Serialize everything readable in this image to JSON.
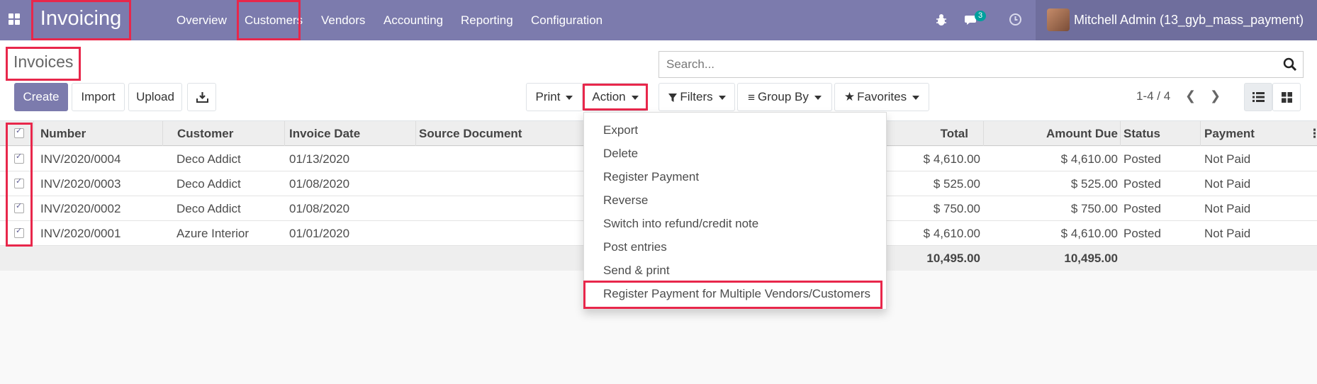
{
  "navbar": {
    "brand": "Invoicing",
    "menu": [
      "Overview",
      "Customers",
      "Vendors",
      "Accounting",
      "Reporting",
      "Configuration"
    ],
    "message_count": "3",
    "user_name": "Mitchell Admin (13_gyb_mass_payment)"
  },
  "page": {
    "title": "Invoices"
  },
  "search": {
    "placeholder": "Search..."
  },
  "buttons": {
    "create": "Create",
    "import": "Import",
    "upload": "Upload",
    "print": "Print",
    "action": "Action",
    "filters": "Filters",
    "group_by": "Group By",
    "favorites": "Favorites"
  },
  "pager": {
    "value": "1-4 / 4"
  },
  "table": {
    "headers": [
      "Number",
      "Customer",
      "Invoice Date",
      "Source Document",
      "Total",
      "Amount Due",
      "Status",
      "Payment"
    ],
    "rows": [
      {
        "number": "INV/2020/0004",
        "customer": "Deco Addict",
        "date": "01/13/2020",
        "total": "$ 4,610.00",
        "amount_due": "$ 4,610.00",
        "status": "Posted",
        "payment": "Not Paid"
      },
      {
        "number": "INV/2020/0003",
        "customer": "Deco Addict",
        "date": "01/08/2020",
        "total": "$ 525.00",
        "amount_due": "$ 525.00",
        "status": "Posted",
        "payment": "Not Paid"
      },
      {
        "number": "INV/2020/0002",
        "customer": "Deco Addict",
        "date": "01/08/2020",
        "total": "$ 750.00",
        "amount_due": "$ 750.00",
        "status": "Posted",
        "payment": "Not Paid"
      },
      {
        "number": "INV/2020/0001",
        "customer": "Azure Interior",
        "date": "01/01/2020",
        "total": "$ 4,610.00",
        "amount_due": "$ 4,610.00",
        "status": "Posted",
        "payment": "Not Paid"
      }
    ],
    "footer": {
      "total": "10,495.00",
      "amount_due": "10,495.00"
    }
  },
  "action_menu": {
    "items": [
      "Export",
      "Delete",
      "Register Payment",
      "Reverse",
      "Switch into refund/credit note",
      "Post entries",
      "Send & print",
      "Register Payment for Multiple Vendors/Customers"
    ]
  },
  "icons": {
    "apps": "apps-grid-icon",
    "bug": "bug-icon",
    "chat": "chat-icon",
    "clock": "clock-icon",
    "search": "search-icon",
    "download": "download-icon",
    "filter": "filter-icon",
    "list": "list-view-icon",
    "kanban": "kanban-view-icon"
  },
  "colors": {
    "navbar": "#7c7bad",
    "primary": "#7c7bad",
    "highlight": "#e8274b",
    "badge": "#00a09d"
  }
}
